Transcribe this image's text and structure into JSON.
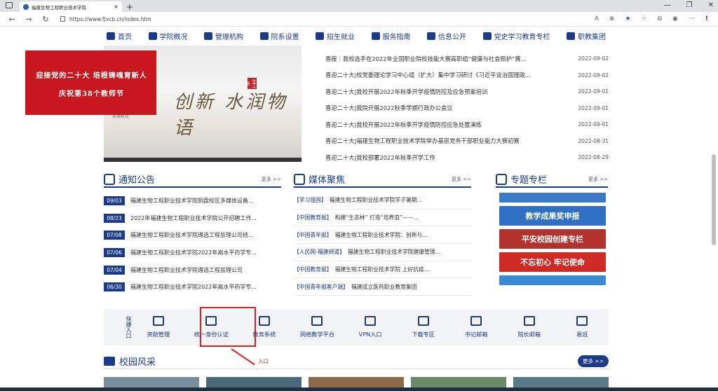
{
  "browser": {
    "tab_title": "福建生物工程职业技术学院",
    "url": "https://www.fjvcb.cn/index.htm",
    "new_tab": "+",
    "close": "×"
  },
  "menu": [
    {
      "label": "首页",
      "icon": "home-icon"
    },
    {
      "label": "学院概况",
      "icon": "building-icon"
    },
    {
      "label": "管理机构",
      "icon": "org-icon"
    },
    {
      "label": "院系设置",
      "icon": "columns-icon"
    },
    {
      "label": "招生就业",
      "icon": "briefcase-icon"
    },
    {
      "label": "服务指南",
      "icon": "handshake-icon"
    },
    {
      "label": "信息公开",
      "icon": "info-icon"
    },
    {
      "label": "党史学习教育专栏",
      "icon": "people-icon"
    },
    {
      "label": "职教集团",
      "icon": "doc-icon"
    }
  ],
  "banner": {
    "calligraphy": "创新 水润物语",
    "seal": "生工院",
    "caption": "美德教化"
  },
  "promo": {
    "line1": "迎接党的二十大 培根铸魂育新人",
    "line2": "庆祝第38个教师节"
  },
  "news": [
    {
      "title": "喜报｜我校选手在2022年全国职业院校技能大赛高职组“健康与社会照护”赛...",
      "date": "2022-09-02"
    },
    {
      "title": "喜迎二十大|校党委理论学习中心组（扩大）集中学习研讨《习近平谈治国理政...",
      "date": "2022-09-02"
    },
    {
      "title": "喜迎二十大|我校开展2022年秋季开学疫情防控及应急预案培训",
      "date": "2022-09-01"
    },
    {
      "title": "喜迎二十大|我院开展2022秋季学期行政办公会议",
      "date": "2022-09-01"
    },
    {
      "title": "喜迎二十大|我校开展2022年秋季开学疫情防控应急处置演练",
      "date": "2022-09-01"
    },
    {
      "title": "喜迎二十大|福建生物工程职业技术学院举办基层党务干部职业能力大赛初赛",
      "date": "2022-08-31"
    },
    {
      "title": "喜迎二十大|我校部署2022年秋季开学工作",
      "date": "2022-08-29"
    }
  ],
  "notices": {
    "title": "通知公告",
    "more": "更多 >>",
    "items": [
      {
        "date": "09/03",
        "title": "福建生物工程职业技术学院铜盘校区多媒体设备..."
      },
      {
        "date": "08/23",
        "title": "2022年福建生物工程职业技术学院公开招聘工作..."
      },
      {
        "date": "07/08",
        "title": "福建生物工程职业技术学院遴选工程监理公司结..."
      },
      {
        "date": "07/06",
        "title": "福建生物工程职业技术学院2022年高水平药学专..."
      },
      {
        "date": "07/04",
        "title": "福建生物工程职业技术学院遴选工程监理公司"
      },
      {
        "date": "06/30",
        "title": "福建生物工程职业技术学院2022年高水平药学专..."
      }
    ]
  },
  "media": {
    "title": "媒体聚焦",
    "more": "更多 >>",
    "items": [
      {
        "tag": "【学习强国】",
        "title": "福建生物工程职业技术学院学子暑期..."
      },
      {
        "tag": "【中国教育报】",
        "title": "构建“生态林” 打造“培养皿”——..."
      },
      {
        "tag": "【中国青年报】",
        "title": "福建生物工程职业技术学院：创新与..."
      },
      {
        "tag": "【人民网-福建频道】",
        "title": "福建生物工程职业技术学院健康管理..."
      },
      {
        "tag": "【中国教育报】",
        "title": "福建生物工程职业技术学院 上好抗疫..."
      },
      {
        "tag": "【中国青年报客户端】",
        "title": "福建成立医药职业教育集团"
      }
    ]
  },
  "special": {
    "title": "专题专栏",
    "more": "更多 >>",
    "items": [
      {
        "text": "",
        "color": "#3a78c8"
      },
      {
        "text": "教学成果奖申报",
        "color": "#2f6fc4"
      },
      {
        "text": "平安校园创建专栏",
        "color": "#b3322c"
      },
      {
        "text": "不忘初心 牢记使命",
        "color": "#d02a26"
      },
      {
        "text": "",
        "color": "#3a8ad8"
      }
    ]
  },
  "quick": {
    "label": "快捷入口",
    "items": [
      {
        "label": "资助管理",
        "icon": "funding-icon"
      },
      {
        "label": "统一身份认证",
        "icon": "auth-icon"
      },
      {
        "label": "教务系统",
        "icon": "academic-icon"
      },
      {
        "label": "网络教学平台",
        "icon": "elearning-icon"
      },
      {
        "label": "VPN入口",
        "icon": "vpn-icon"
      },
      {
        "label": "下载专区",
        "icon": "download-icon"
      },
      {
        "label": "书记邮箱",
        "icon": "mail-icon"
      },
      {
        "label": "院长邮箱",
        "icon": "mail-icon"
      },
      {
        "label": "易班",
        "icon": "yiban-icon"
      }
    ]
  },
  "annotation": {
    "label": "入口"
  },
  "campus": {
    "title": "校园风采",
    "more": "更多 >>"
  }
}
